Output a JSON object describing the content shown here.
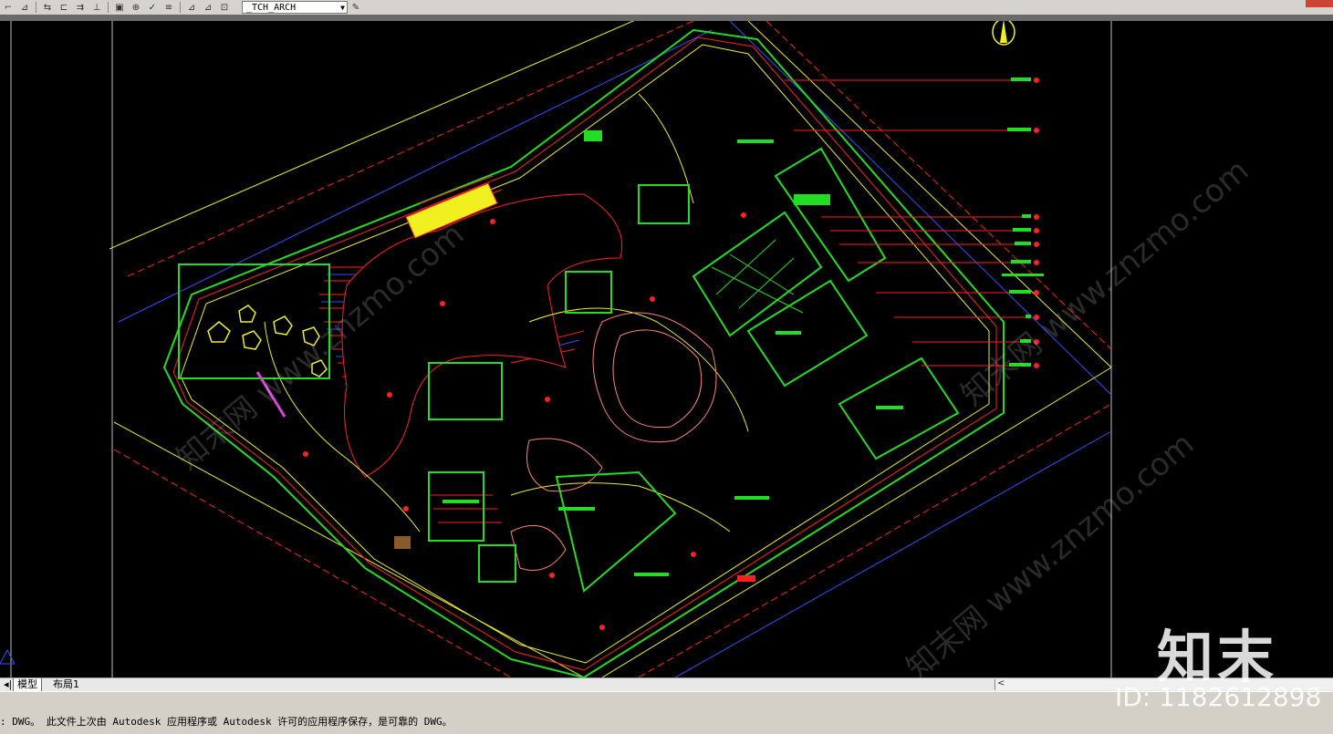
{
  "toolbar": {
    "layer_value": "_TCH_ARCH",
    "icons": [
      "layer-manager-icon",
      "layer-prev-icon",
      "layer-on-icon",
      "dim-linear-icon",
      "dim-aligned-icon",
      "dim-angular-icon",
      "block-icon",
      "snap-icon",
      "check-icon",
      "properties-icon",
      "match-icon",
      "paint-icon",
      "text-style-icon"
    ]
  },
  "tabs": {
    "model": "模型",
    "layout": "布局1"
  },
  "status": {
    "message": ": DWG。  此文件上次由 Autodesk 应用程序或 Autodesk 许可的应用程序保存，是可靠的 DWG。"
  },
  "watermark": {
    "logo": "知末",
    "id": "ID: 1182612898",
    "site": "知末网 www.znzmo.com"
  },
  "colors": {
    "canvas": "#000000",
    "cad_green": "#22dd22",
    "cad_red": "#ff2020",
    "cad_yellow": "#f0f020",
    "cad_blue": "#3050ff"
  }
}
